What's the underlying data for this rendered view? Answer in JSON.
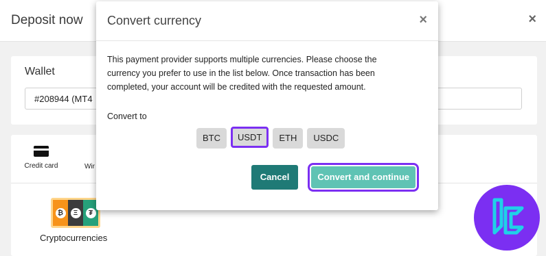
{
  "background": {
    "title": "Deposit now",
    "close_symbol": "×",
    "wallet": {
      "label": "Wallet",
      "selected_value": "#208944 (MT4"
    },
    "methods": {
      "tabs": [
        {
          "label": "Credit card",
          "icon": "credit-card-icon"
        },
        {
          "label": "Wir",
          "icon": "wire-icon"
        }
      ],
      "tile": {
        "label": "Cryptocurrencies",
        "coins": [
          "bitcoin",
          "ethereum",
          "tether"
        ],
        "coin_glyphs": [
          "₿",
          "Ξ",
          "₮"
        ],
        "coin_colors": [
          "#f7931a",
          "#3c3c3d",
          "#26a17b"
        ]
      }
    }
  },
  "modal": {
    "title": "Convert currency",
    "close_symbol": "×",
    "description": "This payment provider supports multiple currencies. Please choose the currency you prefer to use in the list below. Once transaction has been completed, your account will be credited with the requested amount.",
    "convert_to_label": "Convert to",
    "currencies": [
      "BTC",
      "USDT",
      "ETH",
      "USDC"
    ],
    "selected_currency": "USDT",
    "cancel_label": "Cancel",
    "convert_label": "Convert and continue"
  },
  "colors": {
    "accent_highlight": "#7b2ff2",
    "cancel_button": "#1f7a76",
    "convert_button": "#5fc3b4",
    "logo_background": "#7b2ff2",
    "logo_mark": "#1fd1e8"
  }
}
